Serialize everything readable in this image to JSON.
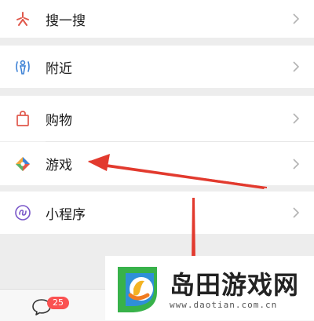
{
  "menu": {
    "items": [
      {
        "label": "搜一搜",
        "icon": "search-sparkle-icon"
      },
      {
        "label": "附近",
        "icon": "nearby-person-icon"
      },
      {
        "label": "购物",
        "icon": "shopping-bag-icon"
      },
      {
        "label": "游戏",
        "icon": "game-diamond-icon"
      },
      {
        "label": "小程序",
        "icon": "mini-program-icon"
      }
    ]
  },
  "bottom_bar": {
    "chats_badge": "25"
  },
  "watermark": {
    "title": "岛田游戏网",
    "url": "www.daotian.com.cn"
  },
  "colors": {
    "arrow": "#e23a2e",
    "badge": "#fa5151",
    "background": "#ededed"
  }
}
